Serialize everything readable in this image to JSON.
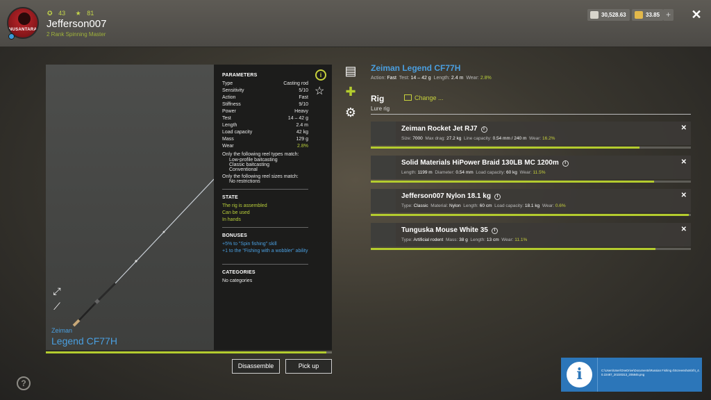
{
  "player": {
    "stat_one": "43",
    "stat_two": "81",
    "username": "Jefferson007",
    "rank": "2 Rank Spinning Master",
    "avatar_text": "NUSANTARA"
  },
  "currency": {
    "silver": "30,528.63",
    "gold": "33.85",
    "plus": "+"
  },
  "close": "✕",
  "preview": {
    "brand": "Zeiman",
    "model": "Legend CF77H",
    "progress": 0.98
  },
  "params": {
    "heading": "PARAMETERS",
    "rows": [
      {
        "k": "Type",
        "v": "Casting rod"
      },
      {
        "k": "Sensitivity",
        "v": "5/10"
      },
      {
        "k": "Action",
        "v": "Fast"
      },
      {
        "k": "Stiffness",
        "v": "9/10"
      },
      {
        "k": "Power",
        "v": "Heavy"
      },
      {
        "k": "Test",
        "v": "14 – 42 g"
      },
      {
        "k": "Length",
        "v": "2.4 m"
      },
      {
        "k": "Load capacity",
        "v": "42 kg"
      },
      {
        "k": "Mass",
        "v": "129 g"
      },
      {
        "k": "Wear",
        "v": "2.8%"
      }
    ],
    "reel_types_title": "Only the following reel types match:",
    "reel_types": [
      "Low-profile baitcasting",
      "Classic baitcasting",
      "Conventional"
    ],
    "reel_sizes_title": "Only the following reel sizes match:",
    "reel_sizes": "No restrictions",
    "state_heading": "STATE",
    "state": [
      "The rig is assembled",
      "Can be used",
      "In hands"
    ],
    "bonuses_heading": "BONUSES",
    "bonus_one": "+5% to \"Spin fishing\" skill",
    "bonus_two": "+1 to the \"Fishing with a wobbler\" ability",
    "categories_heading": "CATEGORIES",
    "categories": "No categories"
  },
  "buttons": {
    "disassemble": "Disassemble",
    "pickup": "Pick up"
  },
  "rod": {
    "title": "Zeiman Legend CF77H",
    "action_label": "Action:",
    "action": "Fast",
    "test_label": "Test:",
    "test": "14 – 42 g",
    "length_label": "Length:",
    "length": "2.4 m",
    "wear_label": "Wear:",
    "wear": "2.8%"
  },
  "rig": {
    "title": "Rig",
    "subtitle": "Lure rig",
    "change": "Change ..."
  },
  "components": [
    {
      "name": "Zeiman Rocket Jet RJ7",
      "fields": [
        {
          "label": "Size:",
          "value": "7000"
        },
        {
          "label": "Max drag:",
          "value": "27.2 kg"
        },
        {
          "label": "Line capacity:",
          "value": "0.54 mm / 240 m"
        },
        {
          "label": "Wear:",
          "value": "16.2%"
        }
      ],
      "condition": 0.84
    },
    {
      "name": "Solid Materials HiPower Braid 130LB MC 1200m",
      "fields": [
        {
          "label": "Length:",
          "value": "1199 m"
        },
        {
          "label": "Diameter:",
          "value": "0.54 mm"
        },
        {
          "label": "Load capacity:",
          "value": "60 kg"
        },
        {
          "label": "Wear:",
          "value": "11.5%"
        }
      ],
      "condition": 0.885
    },
    {
      "name": "Jefferson007 Nylon 18.1 kg",
      "fields": [
        {
          "label": "Type:",
          "value": "Classic"
        },
        {
          "label": "Material:",
          "value": "Nylon"
        },
        {
          "label": "Length:",
          "value": "60 cm"
        },
        {
          "label": "Load capacity:",
          "value": "18.1 kg"
        },
        {
          "label": "Wear:",
          "value": "0.6%"
        }
      ],
      "condition": 0.994
    },
    {
      "name": "Tunguska Mouse White 35",
      "fields": [
        {
          "label": "Type:",
          "value": "Artificial rodent"
        },
        {
          "label": "Mass:",
          "value": "38 g"
        },
        {
          "label": "Length:",
          "value": "13 cm"
        },
        {
          "label": "Wear:",
          "value": "11.1%"
        }
      ],
      "condition": 0.889
    }
  ],
  "notification": {
    "text": "C:\\Users\\User\\OneDrive\\Documents\\Russian Fishing 4\\Screenshots\\rf4_4.0.22487_20220313_205845.png"
  },
  "colors": {
    "accent_green": "#b4cc2e",
    "accent_blue": "#4a9fe0",
    "notification_blue": "#2c76b9"
  },
  "icons": {
    "stat_one": "gear-ring-icon",
    "stat_two": "star-icon",
    "silver": "silver-currency-icon",
    "gold": "gold-currency-icon",
    "info": "info-icon",
    "favorite": "star-outline-icon",
    "expand": "expand-icon",
    "assemble": "tool-icon",
    "doc": "document-icon",
    "puzzle": "puzzle-icon",
    "settings": "gear-icon",
    "help": "help-icon"
  }
}
